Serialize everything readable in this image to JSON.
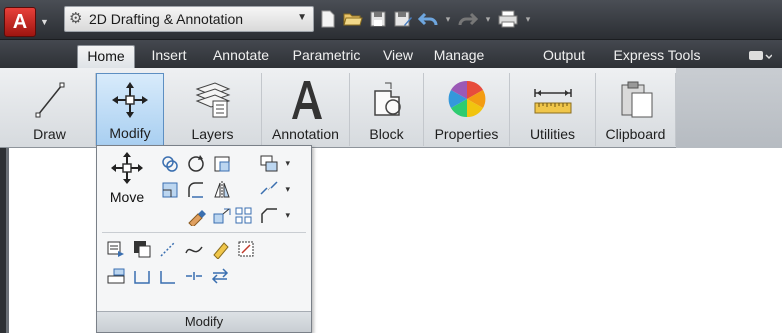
{
  "app": {
    "workspace_select": "2D Drafting & Annotation"
  },
  "quick_access": {
    "icons": [
      "new-icon",
      "open-icon",
      "save-icon",
      "save-as-icon",
      "undo-icon",
      "redo-icon",
      "plot-icon",
      "customize-icon"
    ]
  },
  "tabs": [
    {
      "label": "Home",
      "active": true
    },
    {
      "label": "Insert"
    },
    {
      "label": "Annotate"
    },
    {
      "label": "Parametric"
    },
    {
      "label": "View"
    },
    {
      "label": "Manage"
    },
    {
      "label": "Output"
    },
    {
      "label": "Express Tools"
    }
  ],
  "ribbon": {
    "panels": [
      {
        "label": "Draw",
        "icon": "line-icon"
      },
      {
        "label": "Modify",
        "icon": "move-icon",
        "active": true
      },
      {
        "label": "Layers",
        "icon": "layers-icon"
      },
      {
        "label": "Annotation",
        "icon": "text-icon"
      },
      {
        "label": "Block",
        "icon": "block-icon"
      },
      {
        "label": "Properties",
        "icon": "color-wheel-icon"
      },
      {
        "label": "Utilities",
        "icon": "measure-icon"
      },
      {
        "label": "Clipboard",
        "icon": "paste-icon"
      }
    ]
  },
  "dropdown": {
    "move_label": "Move",
    "footer_label": "Modify"
  },
  "colors": {
    "qat_bg": "#2b2e33",
    "ribbon_bg": "#e6e8eb",
    "active_blue": "#a9cff1",
    "accent_red": "#c62a22"
  }
}
